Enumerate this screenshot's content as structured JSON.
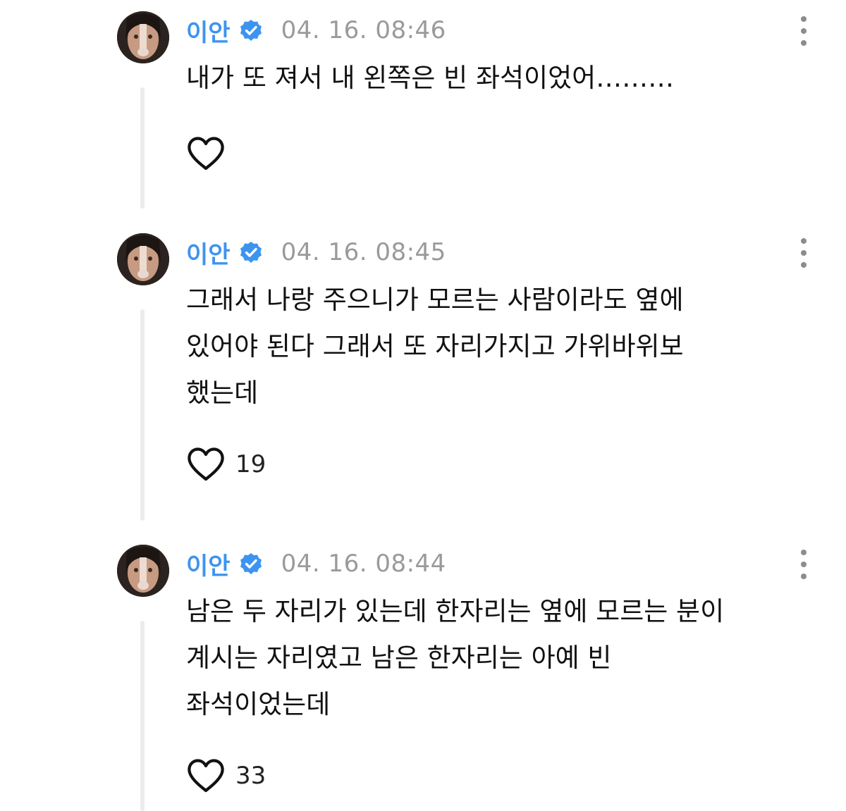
{
  "colors": {
    "username": "#3d94f0",
    "verified_badge": "#3d94f0",
    "timestamp": "#9a9a9a",
    "thread_line": "#ececec",
    "text": "#111111"
  },
  "icons": {
    "verified": "verified-badge-icon",
    "more": "more-vertical-icon",
    "like": "heart-outline-icon"
  },
  "comments": [
    {
      "username": "이안",
      "timestamp": "04. 16. 08:46",
      "text": "내가 또 져서 내 왼쪽은 빈 좌석이었어………",
      "likes": ""
    },
    {
      "username": "이안",
      "timestamp": "04. 16. 08:45",
      "text": "그래서 나랑 주으니가 모르는 사람이라도 옆에\n있어야 된다 그래서 또 자리가지고 가위바위보\n했는데",
      "likes": "19"
    },
    {
      "username": "이안",
      "timestamp": "04. 16. 08:44",
      "text": "남은 두 자리가 있는데 한자리는 옆에 모르는 분이\n계시는 자리였고 남은 한자리는 아예 빈\n좌석이었는데",
      "likes": "33"
    }
  ]
}
